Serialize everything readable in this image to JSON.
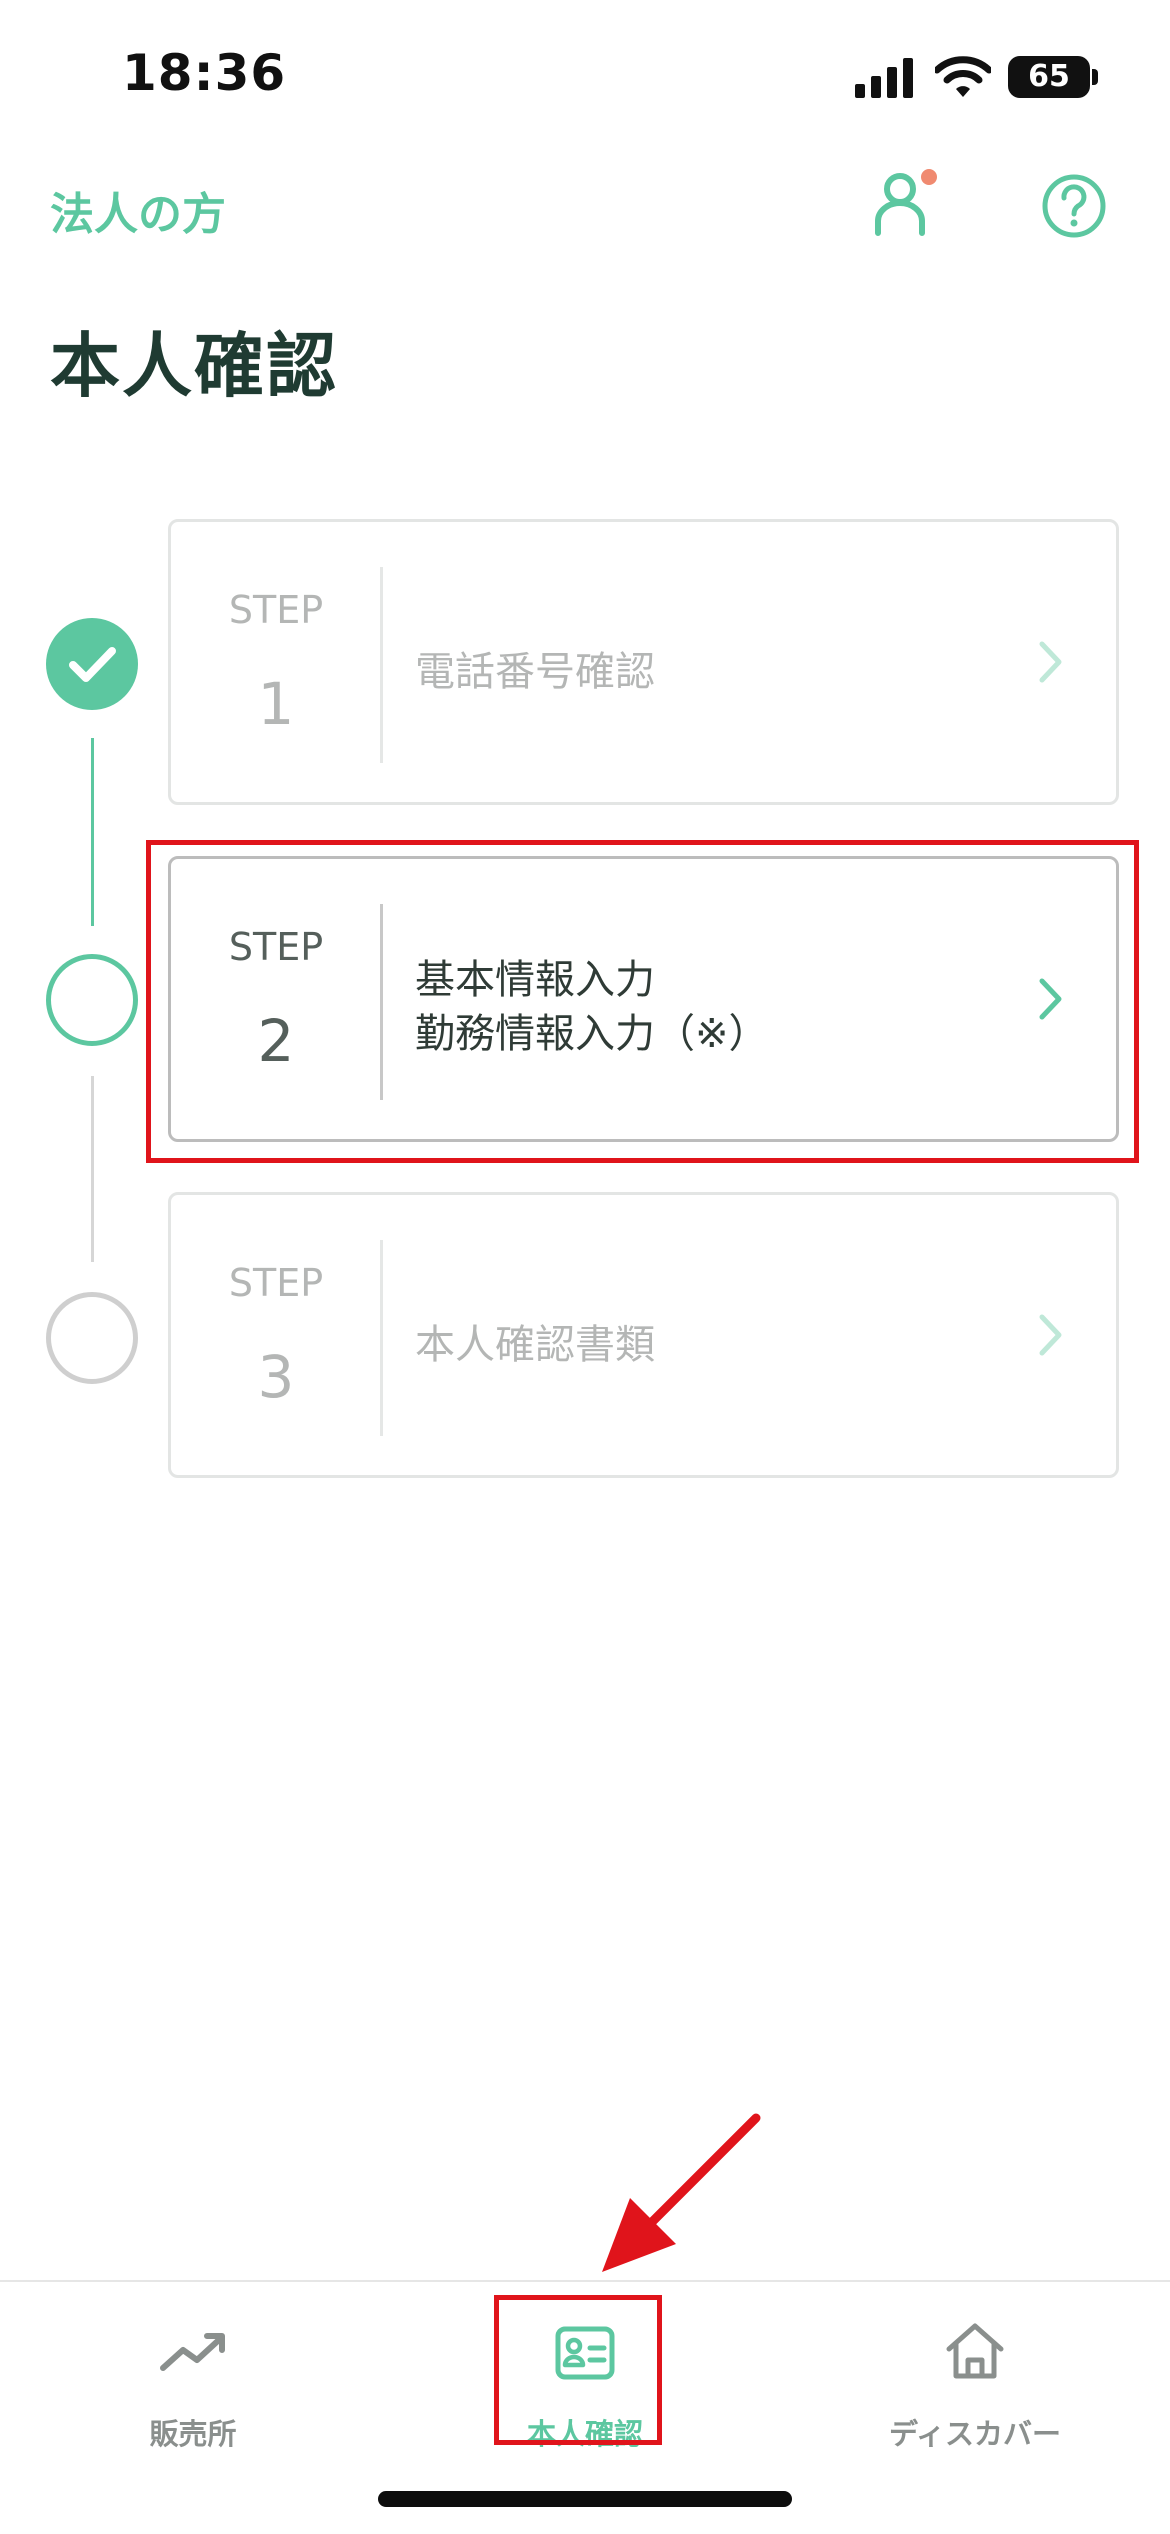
{
  "status_bar": {
    "time": "18:36",
    "battery": "65"
  },
  "header": {
    "corporate_link": "法人の方",
    "title": "本人確認"
  },
  "steps": [
    {
      "step_word": "STEP",
      "number": "1",
      "lines": [
        "電話番号確認"
      ],
      "status": "completed"
    },
    {
      "step_word": "STEP",
      "number": "2",
      "lines": [
        "基本情報入力",
        "勤務情報入力（※）"
      ],
      "status": "current"
    },
    {
      "step_word": "STEP",
      "number": "3",
      "lines": [
        "本人確認書類"
      ],
      "status": "pending"
    }
  ],
  "tabs": [
    {
      "label": "販売所",
      "icon": "trend-up-icon",
      "active": false
    },
    {
      "label": "本人確認",
      "icon": "id-card-icon",
      "active": true
    },
    {
      "label": "ディスカバー",
      "icon": "home-icon",
      "active": false
    }
  ],
  "colors": {
    "accent": "#5cc7a0",
    "title": "#1f3b32",
    "highlight": "#e0141b",
    "notification_dot": "#f08a70"
  }
}
